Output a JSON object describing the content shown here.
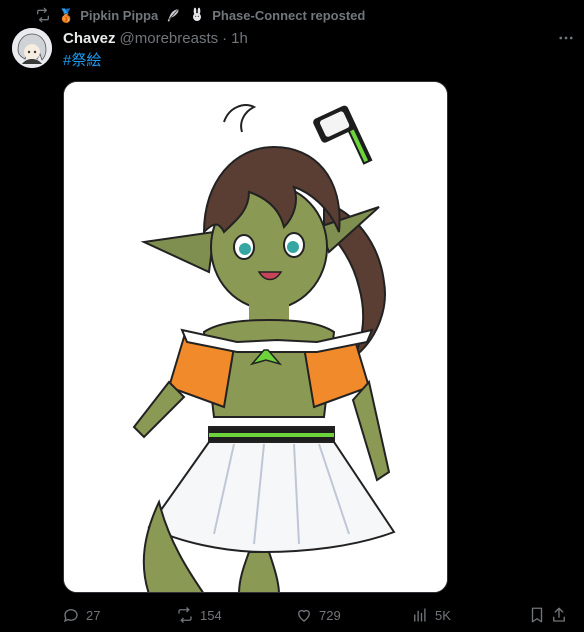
{
  "repost": {
    "user_name": "Pipkin Pippa",
    "label": "Phase-Connect reposted",
    "badge_emoji": "🥉",
    "icons": [
      "repost-icon",
      "medal-icon",
      "feather-icon",
      "rabbit-icon"
    ]
  },
  "tweet": {
    "display_name": "Chavez",
    "handle": "@morebreasts",
    "separator": "·",
    "time": "1h",
    "text": "#祭絵",
    "more_label": "···"
  },
  "stats": {
    "replies": "27",
    "reposts": "154",
    "likes": "729",
    "views": "5K"
  },
  "colors": {
    "background": "#000000",
    "text_primary": "#e7e9ea",
    "text_secondary": "#71767b",
    "link": "#1d9bf0",
    "border": "#2f3336"
  }
}
